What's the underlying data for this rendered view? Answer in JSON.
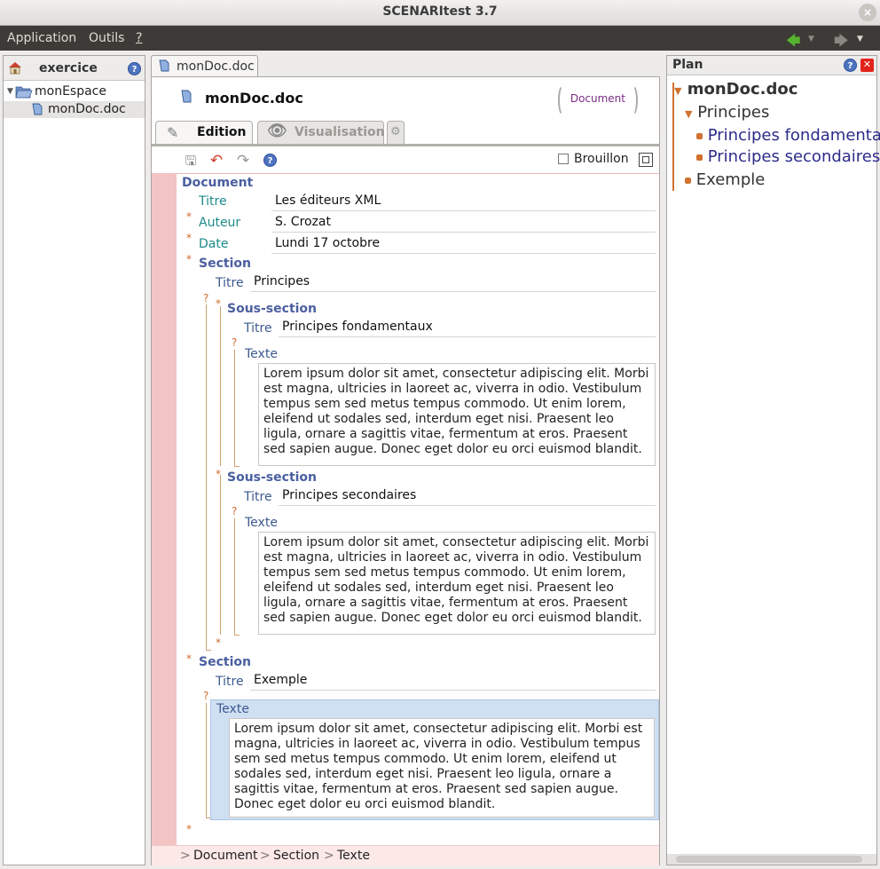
{
  "window": {
    "title": "SCENARItest 3.7",
    "close_glyph": "×"
  },
  "menubar": {
    "items": [
      {
        "label": "Application",
        "mnemonic": "p"
      },
      {
        "label": "Outils",
        "mnemonic": "t"
      },
      {
        "label": "?"
      }
    ],
    "nav_back": "back-arrow-icon",
    "nav_forward": "forward-arrow-icon"
  },
  "left_panel": {
    "title": "exercice",
    "help": "?",
    "tree": [
      {
        "label": "monEspace",
        "type": "folder",
        "expanded": true
      },
      {
        "label": "monDoc.doc",
        "type": "file",
        "selected": true
      }
    ]
  },
  "editor": {
    "tab_label": "monDoc.doc",
    "doc_name": "monDoc.doc",
    "doc_type_badge": "Document",
    "view_tabs": [
      {
        "label": "Edition",
        "active": true
      },
      {
        "label": "Visualisation",
        "active": false
      }
    ],
    "draft_label": "Brouillon",
    "draft_checked": false,
    "root": "Document",
    "fields": {
      "titre_label": "Titre",
      "titre_value": "Les éditeurs XML",
      "auteur_label": "Auteur",
      "auteur_value": "S. Crozat",
      "date_label": "Date",
      "date_value": "Lundi 17 octobre"
    },
    "section1": {
      "label": "Section",
      "titre_label": "Titre",
      "titre_value": "Principes",
      "sub1": {
        "label": "Sous-section",
        "titre_label": "Titre",
        "titre_value": "Principes fondamentaux",
        "texte_label": "Texte"
      },
      "sub2": {
        "label": "Sous-section",
        "titre_label": "Titre",
        "titre_value": "Principes secondaires",
        "texte_label": "Texte"
      }
    },
    "section2": {
      "label": "Section",
      "titre_label": "Titre",
      "titre_value": "Exemple",
      "texte_label": "Texte"
    },
    "lorem": "Lorem ipsum dolor sit amet, consectetur adipiscing elit. Morbi est magna, ultricies in laoreet ac, viverra in odio. Vestibulum tempus sem sed metus tempus commodo. Ut enim lorem, eleifend ut sodales sed, interdum eget nisi. Praesent leo ligula, ornare a sagittis vitae, fermentum at eros. Praesent sed sapien augue. Donec eget dolor eu orci euismod blandit.",
    "breadcrumb": [
      "Document",
      "Section",
      "Texte"
    ],
    "breadcrumb_sep": ">"
  },
  "plan": {
    "title": "Plan",
    "items": [
      {
        "label": "monDoc.doc",
        "level": 0,
        "bold": true
      },
      {
        "label": "Principes",
        "level": 1
      },
      {
        "label": "Principes fondamentaux",
        "level": 2
      },
      {
        "label": "Principes secondaires",
        "level": 2
      },
      {
        "label": "Exemple",
        "level": 1
      }
    ],
    "colors": {
      "bullet": "#d0722f",
      "link": "#2c2c8a"
    }
  }
}
